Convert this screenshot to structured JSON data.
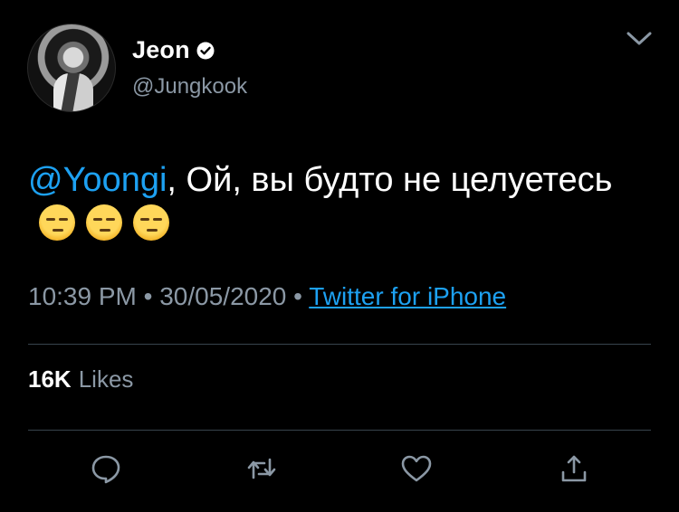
{
  "profile": {
    "display_name": "Jeon",
    "handle": "@Jungkook",
    "verified": true
  },
  "tweet": {
    "mention": "@Yoongi",
    "text": ", Ой, вы будто не целуетесь",
    "emojis": [
      "unamused-face-emoji",
      "unamused-face-emoji",
      "unamused-face-emoji"
    ]
  },
  "meta": {
    "time": "10:39 PM",
    "separator": "•",
    "date": "30/05/2020",
    "source": "Twitter for iPhone"
  },
  "stats": {
    "likes_count": "16K",
    "likes_label": "Likes"
  },
  "icons": {
    "menu": "chevron-down-icon",
    "reply": "reply-icon",
    "retweet": "retweet-icon",
    "like": "heart-icon",
    "share": "share-icon"
  },
  "colors": {
    "background": "#000000",
    "accent": "#1da1f2",
    "secondary_text": "#8b98a5",
    "divider": "#38444d"
  }
}
